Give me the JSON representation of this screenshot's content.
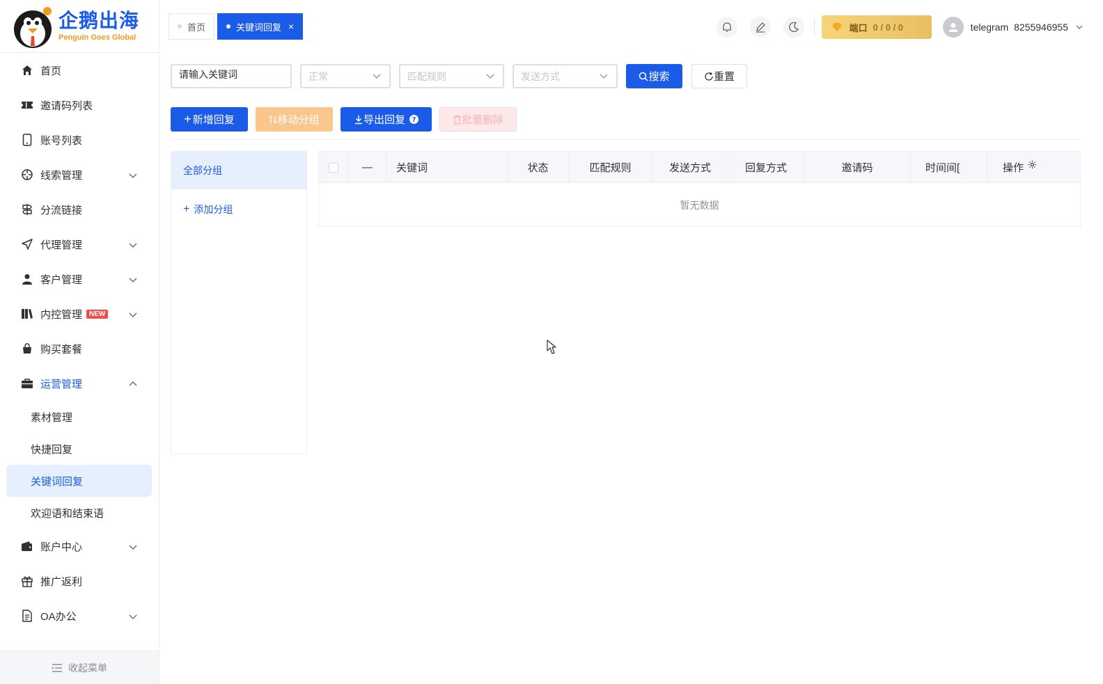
{
  "brand": {
    "name_cn": "企鹅出海",
    "name_en": "Penguin Goes Global"
  },
  "sidebar": {
    "items": [
      {
        "label": "首页",
        "icon": "home-icon"
      },
      {
        "label": "邀请码列表",
        "icon": "ticket-icon"
      },
      {
        "label": "账号列表",
        "icon": "phone-icon"
      },
      {
        "label": "线索管理",
        "icon": "crosshair-icon",
        "expandable": true
      },
      {
        "label": "分流链接",
        "icon": "signpost-icon"
      },
      {
        "label": "代理管理",
        "icon": "send-icon",
        "expandable": true
      },
      {
        "label": "客户管理",
        "icon": "user-icon",
        "expandable": true
      },
      {
        "label": "内控管理",
        "icon": "books-icon",
        "expandable": true,
        "badge": "NEW"
      },
      {
        "label": "购买套餐",
        "icon": "bag-icon"
      },
      {
        "label": "运营管理",
        "icon": "briefcase-icon",
        "expandable": true,
        "open": true
      }
    ],
    "subitems": [
      {
        "label": "素材管理"
      },
      {
        "label": "快捷回复"
      },
      {
        "label": "关键词回复",
        "active": true
      },
      {
        "label": "欢迎语和结束语"
      }
    ],
    "items_after": [
      {
        "label": "账户中心",
        "icon": "wallet-icon",
        "expandable": true
      },
      {
        "label": "推广返利",
        "icon": "gift-icon"
      },
      {
        "label": "OA办公",
        "icon": "document-icon",
        "expandable": true
      }
    ],
    "collapse_label": "收起菜单"
  },
  "tabs": [
    {
      "label": "首页",
      "active": false
    },
    {
      "label": "关键词回复",
      "active": true,
      "close": "×"
    }
  ],
  "topbar": {
    "port_label": "端口",
    "port_value": "0 / 0 / 0",
    "username": "telegram",
    "user_id": "8255946955"
  },
  "filters": {
    "keyword_placeholder": "请输入关键词",
    "status_placeholder": "正常",
    "match_placeholder": "匹配规则",
    "send_placeholder": "发送方式",
    "search_label": "搜索",
    "reset_label": "重置"
  },
  "actions": {
    "add_label": "新增回复",
    "move_label": "移动分组",
    "export_label": "导出回复",
    "delete_label": "批量删除"
  },
  "groups": {
    "all_label": "全部分组",
    "add_label": "添加分组"
  },
  "table": {
    "columns": [
      "—",
      "关键词",
      "状态",
      "匹配规则",
      "发送方式",
      "回复方式",
      "邀请码",
      "时间间[",
      "操作"
    ],
    "empty_text": "暂无数据"
  },
  "colors": {
    "primary": "#1a5be8",
    "active_bg": "#e6effd",
    "warning": "#f9c78b",
    "danger_disabled": "#fbd4d4",
    "gold": "#e8c062"
  }
}
